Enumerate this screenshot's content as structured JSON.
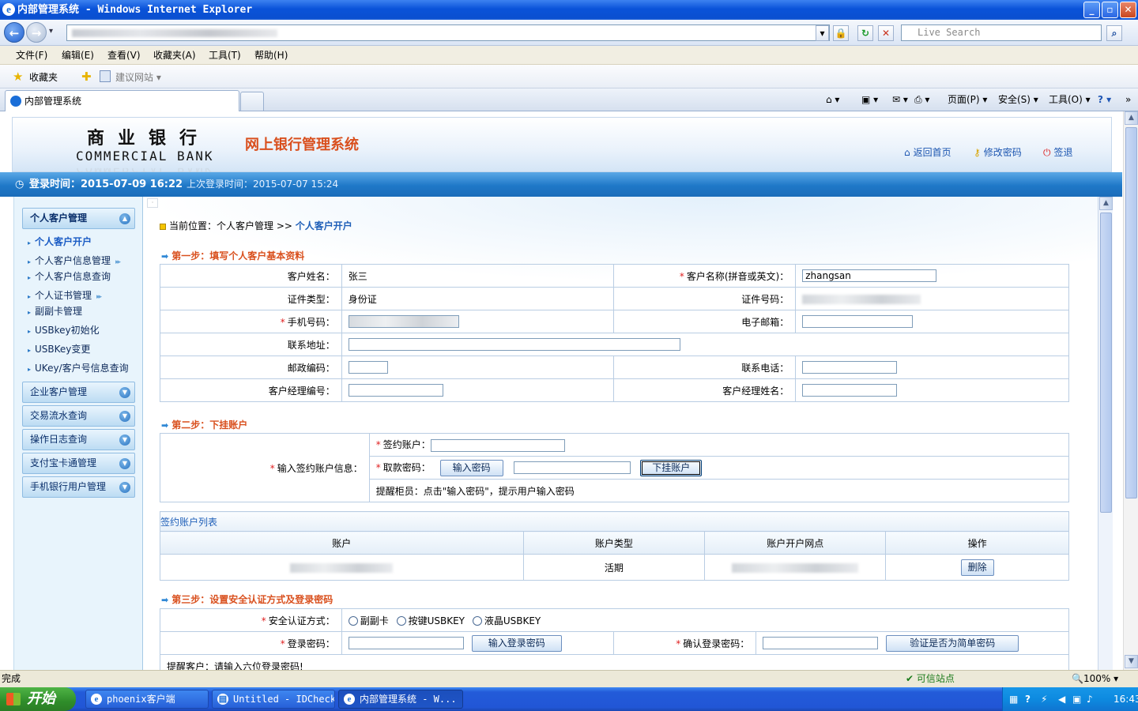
{
  "window": {
    "title": "内部管理系统 - Windows Internet Explorer",
    "ie_glyph": "e",
    "minimize": "_",
    "maximize": "▫",
    "close": "✕"
  },
  "addressbar": {
    "back": "←",
    "forward": "→",
    "dropdown": "▾",
    "lock": "🔒",
    "refresh": "↻",
    "stop": "✕",
    "search_placeholder": "Live Search",
    "search_go": "⌕"
  },
  "menu": [
    "文件(F)",
    "编辑(E)",
    "查看(V)",
    "收藏夹(A)",
    "工具(T)",
    "帮助(H)"
  ],
  "favorites": {
    "label": "收藏夹",
    "suggested": "建议网站 ▾"
  },
  "tabs": [
    {
      "label": "内部管理系统"
    }
  ],
  "commandbar": {
    "home": "⌂ ▾",
    "feeds": "▣ ▾",
    "mail": "✉ ▾",
    "print": "⎙ ▾",
    "page": "页面(P) ▾",
    "safety": "安全(S) ▾",
    "tools": "工具(O) ▾",
    "help": "? ▾",
    "more": "»"
  },
  "header": {
    "logo_cn": "商业银行",
    "logo_en": "COMMERCIAL BANK",
    "system_title": "网上银行管理系统",
    "links": [
      {
        "icon": "home-icon",
        "glyph": "⌂",
        "label": "返回首页"
      },
      {
        "icon": "key-icon",
        "glyph": "⚷",
        "label": "修改密码"
      },
      {
        "icon": "power-icon",
        "glyph": "⏻",
        "label": "签退"
      }
    ]
  },
  "loginbar": {
    "login_time": "登录时间：2015-07-09 16:22",
    "last_login": "上次登录时间：2015-07-07 15:24"
  },
  "sidebar": {
    "sections": [
      {
        "label": "个人客户管理",
        "toggle": "▲"
      },
      {
        "label": "企业客户管理",
        "toggle": "▼"
      },
      {
        "label": "交易流水查询",
        "toggle": "▼"
      },
      {
        "label": "操作日志查询",
        "toggle": "▼"
      },
      {
        "label": "支付宝卡通管理",
        "toggle": "▼"
      },
      {
        "label": "手机银行用户管理",
        "toggle": "▼"
      }
    ],
    "items": [
      {
        "label": "个人客户开户"
      },
      {
        "label": "个人客户信息管理"
      },
      {
        "label": "个人客户信息查询"
      },
      {
        "label": "个人证书管理"
      },
      {
        "label": "副副卡管理"
      },
      {
        "label": "USBkey初始化"
      },
      {
        "label": "USBKey变更"
      },
      {
        "label": "UKey/客户号信息查询"
      }
    ],
    "bullet": "▸",
    "more": "▸▸"
  },
  "breadcrumb": {
    "prefix": "当前位置：个人客户管理 >>",
    "current": "个人客户开户"
  },
  "step1": {
    "title": "第一步：填写个人客户基本资料",
    "name_label": "客户姓名：",
    "name_value": "张三",
    "ename_label": "客户名称(拼音或英文)：",
    "ename_value": "zhangsan",
    "idtype_label": "证件类型：",
    "idtype_value": "身份证",
    "idno_label": "证件号码：",
    "mobile_label": "手机号码：",
    "email_label": "电子邮箱：",
    "address_label": "联系地址：",
    "zip_label": "邮政编码：",
    "phone_label": "联系电话：",
    "mgr_no_label": "客户经理编号：",
    "mgr_name_label": "客户经理姓名："
  },
  "step2": {
    "title": "第二步：下挂账户",
    "info_label": "输入签约账户信息：",
    "account_label": "签约账户：",
    "pwd_label": "取款密码：",
    "pwd_btn": "输入密码",
    "attach_btn": "下挂账户",
    "hint": "提醒柜员：点击\"输入密码\"，提示用户输入密码"
  },
  "account_list": {
    "title": "签约账户列表",
    "columns": [
      "账户",
      "账户类型",
      "账户开户网点",
      "操作"
    ],
    "rows": [
      {
        "type": "活期",
        "action": "删除"
      }
    ]
  },
  "step3": {
    "title": "第三步：设置安全认证方式及登录密码",
    "auth_label": "安全认证方式：",
    "auth_options": [
      "副副卡",
      "按键USBKEY",
      "液晶USBKEY"
    ],
    "pwd_label": "登录密码：",
    "pwd_btn": "输入登录密码",
    "confirm_label": "确认登录密码：",
    "verify_btn": "验证是否为简单密码",
    "hint": "提醒客户：请输入六位登录密码!"
  },
  "statusbar": {
    "left": "完成",
    "trusted": "✔ 可信站点",
    "zoom": "🔍100% ▾"
  },
  "taskbar": {
    "start": "开始",
    "tasks": [
      {
        "label": "phoenix客户端"
      },
      {
        "label": "Untitled - IDCheck"
      },
      {
        "label": "内部管理系统 - W..."
      }
    ],
    "clock": "16:43"
  }
}
